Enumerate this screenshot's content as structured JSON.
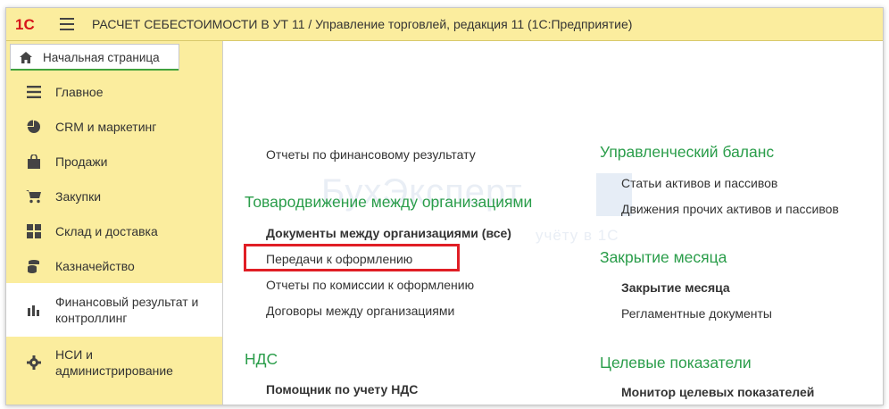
{
  "app": {
    "logo_text": "1С",
    "title": "РАСЧЕТ СЕБЕСТОИМОСТИ В УТ 11 / Управление торговлей, редакция 11  (1С:Предприятие)"
  },
  "home_tab": {
    "label": "Начальная страница"
  },
  "sidebar": {
    "items": [
      {
        "label": "Главное",
        "icon": "menu-lines-icon"
      },
      {
        "label": "CRM и маркетинг",
        "icon": "pie-chart-icon"
      },
      {
        "label": "Продажи",
        "icon": "shopping-bag-icon"
      },
      {
        "label": "Закупки",
        "icon": "cart-icon"
      },
      {
        "label": "Склад и доставка",
        "icon": "grid-blocks-icon"
      },
      {
        "label": "Казначейство",
        "icon": "coins-icon"
      },
      {
        "label": "Финансовый результат и контроллинг",
        "icon": "bar-chart-icon",
        "active": true
      },
      {
        "label": "НСИ и администрирование",
        "icon": "gear-icon"
      }
    ]
  },
  "content": {
    "watermark": {
      "main": "БухЭксперт",
      "sub": "учёту в 1С"
    },
    "left_column": {
      "top_link": "Отчеты по финансовому результату",
      "section1": {
        "title": "Товародвижение между организациями",
        "links": [
          {
            "label": "Документы между организациями (все)",
            "bold": true
          },
          {
            "label": "Передачи к оформлению",
            "highlighted": true
          },
          {
            "label": "Отчеты по комиссии к оформлению"
          },
          {
            "label": "Договоры между организациями"
          }
        ]
      },
      "section2": {
        "title": "НДС",
        "links": [
          {
            "label": "Помощник по учету НДС",
            "bold": true
          }
        ]
      }
    },
    "right_column": {
      "section1": {
        "title": "Управленческий баланс",
        "links": [
          {
            "label": "Статьи активов и пассивов"
          },
          {
            "label": "Движения прочих активов и пассивов"
          }
        ]
      },
      "section2": {
        "title": "Закрытие месяца",
        "links": [
          {
            "label": "Закрытие месяца",
            "bold": true
          },
          {
            "label": "Регламентные документы"
          }
        ]
      },
      "section3": {
        "title": "Целевые показатели",
        "links": [
          {
            "label": "Монитор целевых показателей",
            "bold": true
          }
        ]
      }
    }
  },
  "colors": {
    "accent_yellow": "#fbed9e",
    "section_green": "#2a9d4a",
    "highlight_red": "#e01e25",
    "logo_red": "#d7141a"
  }
}
